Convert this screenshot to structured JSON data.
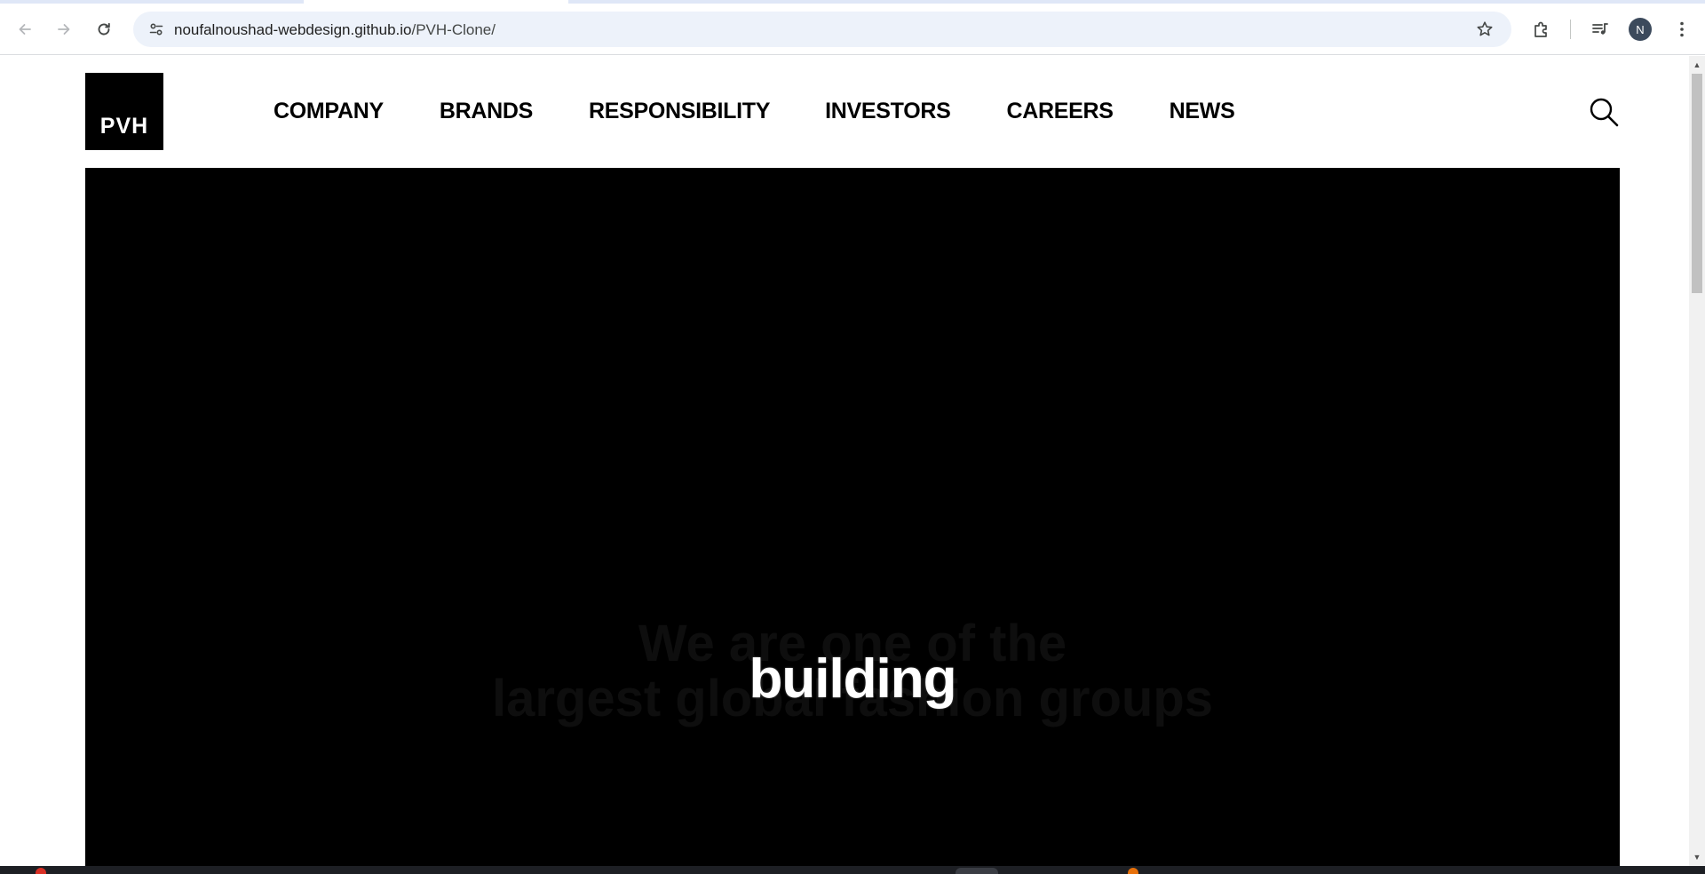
{
  "browser": {
    "url_host": "noufalnoushad-webdesign.github.io",
    "url_path": "/PVH-Clone/",
    "avatar_initial": "N",
    "icons": {
      "back": "arrow-left-icon",
      "forward": "arrow-right-icon",
      "reload": "reload-icon",
      "site_info": "tune-icon",
      "bookmark": "star-icon",
      "extensions": "puzzle-icon",
      "media": "media-queue-icon",
      "menu": "kebab-menu-icon"
    }
  },
  "site": {
    "logo_text": "PVH",
    "nav": [
      {
        "label": "COMPANY"
      },
      {
        "label": "BRANDS"
      },
      {
        "label": "RESPONSIBILITY"
      },
      {
        "label": "INVESTORS"
      },
      {
        "label": "CAREERS"
      },
      {
        "label": "NEWS"
      }
    ],
    "search_icon": "search-icon"
  },
  "hero": {
    "ghost_line_1": "We are one of the",
    "ghost_line_2": "largest global fashion groups",
    "highlight_word": "building"
  },
  "colors": {
    "hero_bg": "#000000",
    "nav_text": "#000000",
    "logo_bg": "#000000"
  }
}
